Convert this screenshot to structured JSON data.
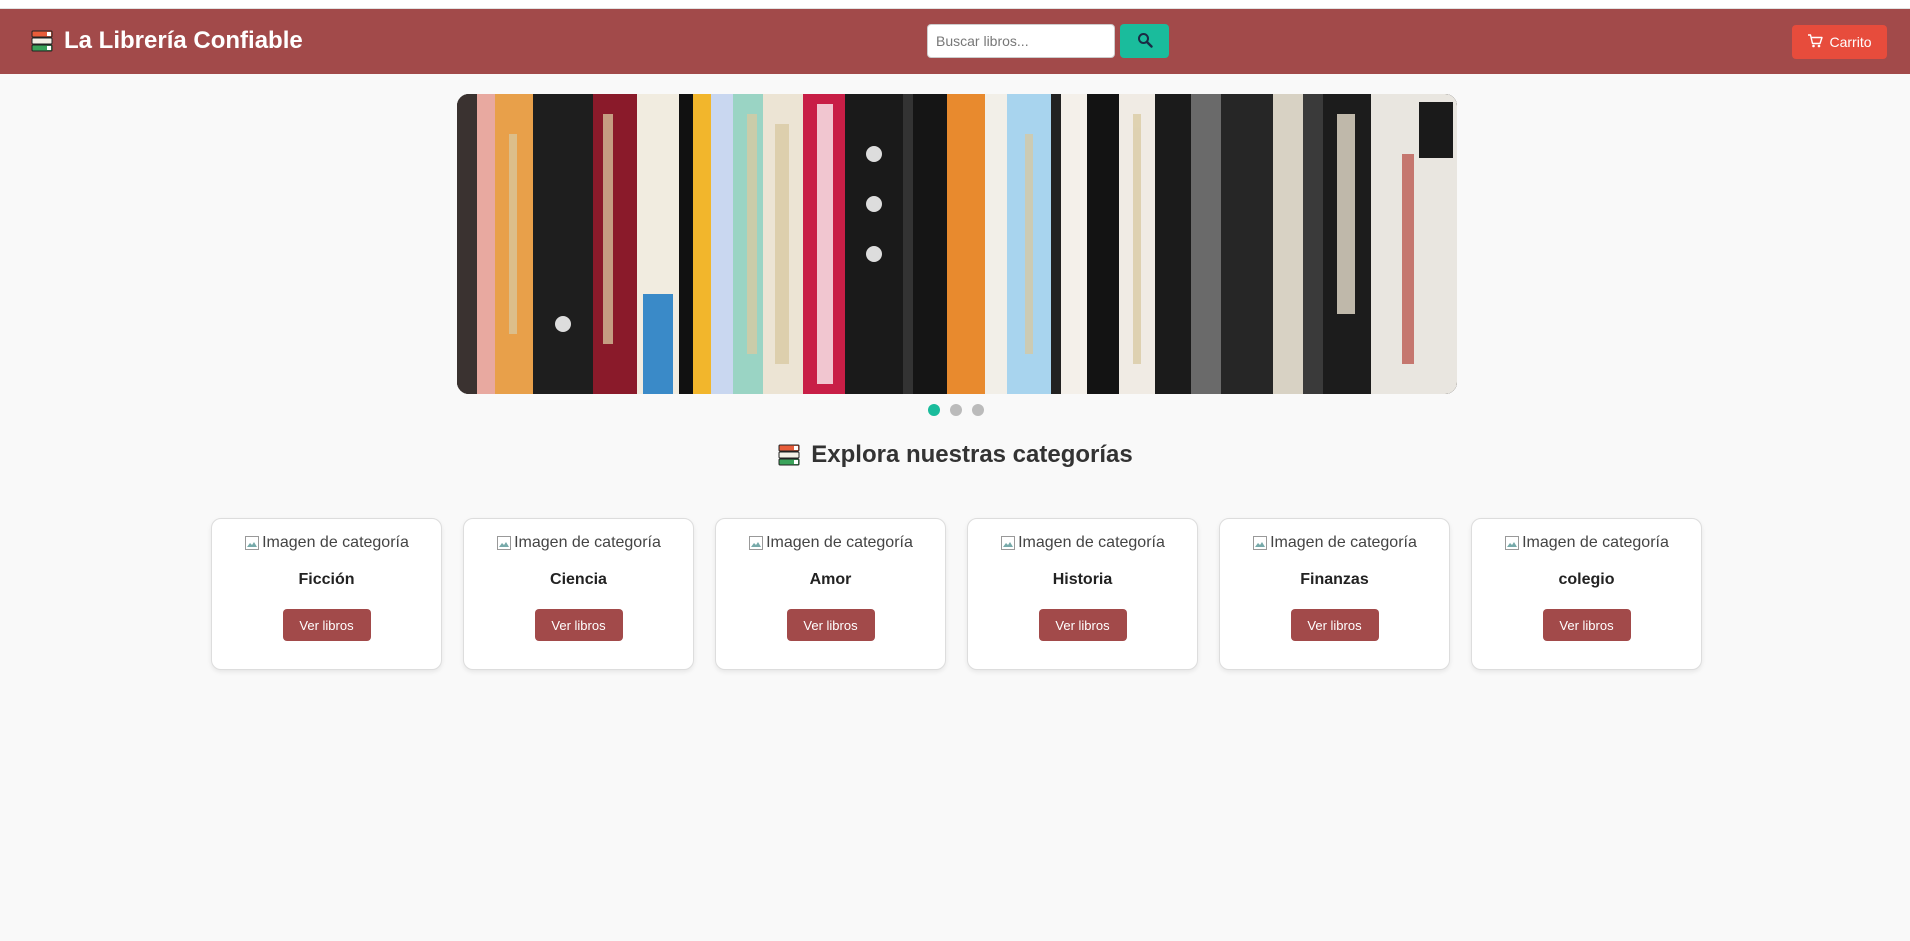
{
  "header": {
    "brand_title": "La Librería Confiable",
    "brand_icon": "books-icon",
    "search": {
      "placeholder": "Buscar libros...",
      "value": "",
      "button_icon": "search-icon"
    },
    "cart_label": "Carrito",
    "cart_icon": "cart-icon"
  },
  "carousel": {
    "slide_count": 3,
    "active_index": 0
  },
  "section": {
    "title": "Explora nuestras categorías",
    "icon": "books-icon"
  },
  "categories": [
    {
      "name": "Ficción",
      "image_alt": "Imagen de categoría",
      "button": "Ver libros"
    },
    {
      "name": "Ciencia",
      "image_alt": "Imagen de categoría",
      "button": "Ver libros"
    },
    {
      "name": "Amor",
      "image_alt": "Imagen de categoría",
      "button": "Ver libros"
    },
    {
      "name": "Historia",
      "image_alt": "Imagen de categoría",
      "button": "Ver libros"
    },
    {
      "name": "Finanzas",
      "image_alt": "Imagen de categoría",
      "button": "Ver libros"
    },
    {
      "name": "colegio",
      "image_alt": "Imagen de categoría",
      "button": "Ver libros"
    }
  ],
  "colors": {
    "header_bg": "#a24a4a",
    "accent": "#1abc9c",
    "cart_button": "#e74c3c",
    "category_button": "#a24a4a",
    "page_bg": "#f9f9f9"
  }
}
